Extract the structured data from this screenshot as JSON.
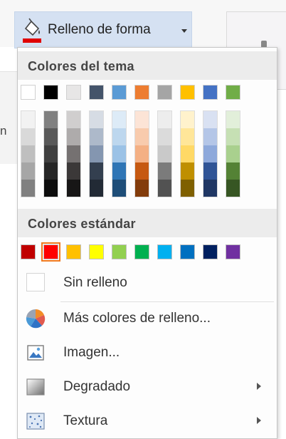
{
  "ribbon": {
    "button_label": "Relleno de forma",
    "edge_text": "n"
  },
  "menu": {
    "theme_header": "Colores del tema",
    "standard_header": "Colores estándar",
    "theme_top": [
      "#ffffff",
      "#000000",
      "#e7e6e6",
      "#44546a",
      "#5b9bd5",
      "#ed7d31",
      "#a5a5a5",
      "#ffc000",
      "#4472c4",
      "#70ad47"
    ],
    "theme_shades": [
      [
        "#f2f2f2",
        "#d9d9d9",
        "#bfbfbf",
        "#a6a6a6",
        "#808080"
      ],
      [
        "#808080",
        "#595959",
        "#404040",
        "#262626",
        "#0d0d0d"
      ],
      [
        "#d0cece",
        "#aeabab",
        "#757171",
        "#3b3838",
        "#171616"
      ],
      [
        "#d6dce4",
        "#adb9ca",
        "#8496b0",
        "#333f4f",
        "#222a35"
      ],
      [
        "#ddebf7",
        "#bdd7ee",
        "#9bc2e6",
        "#2f75b5",
        "#1f4e78"
      ],
      [
        "#fce4d6",
        "#f8cbad",
        "#f4b084",
        "#c65911",
        "#833c0b"
      ],
      [
        "#ededed",
        "#dbdbdb",
        "#c9c9c9",
        "#7b7b7b",
        "#525252"
      ],
      [
        "#fff2cc",
        "#ffe699",
        "#ffd966",
        "#bf8f00",
        "#7f6000"
      ],
      [
        "#d9e1f2",
        "#b4c6e7",
        "#8ea9db",
        "#305496",
        "#203764"
      ],
      [
        "#e2efda",
        "#c6e0b4",
        "#a9d08e",
        "#548235",
        "#375623"
      ]
    ],
    "standard": [
      "#c00000",
      "#ff0000",
      "#ffc000",
      "#ffff00",
      "#92d050",
      "#00b050",
      "#00b0f0",
      "#0070c0",
      "#002060",
      "#7030a0"
    ],
    "selected_standard_index": 1,
    "items": {
      "no_fill": "Sin relleno",
      "more_colors": "Más colores de relleno...",
      "picture": "Imagen...",
      "gradient": "Degradado",
      "texture": "Textura"
    }
  }
}
